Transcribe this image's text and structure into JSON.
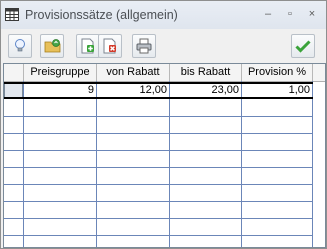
{
  "window": {
    "title": "Provisionssätze (allgemein)"
  },
  "window_controls": {
    "minimize": "–",
    "maximize": "▫",
    "close": "×"
  },
  "toolbar": {
    "buttons": [
      "lightbulb-icon",
      "folder-refresh-icon",
      "add-record-icon",
      "delete-record-icon",
      "print-icon",
      "confirm-check-icon"
    ]
  },
  "table": {
    "columns": [
      "Preisgruppe",
      "von Rabatt",
      "bis Rabatt",
      "Provision %"
    ],
    "rows": [
      {
        "preisgruppe": "9",
        "von_rabatt": "12,00",
        "bis_rabatt": "23,00",
        "provision": "1,00"
      }
    ]
  },
  "colors": {
    "grid_line": "#6b86b8",
    "confirm_green": "#3aa33a",
    "delete_red": "#d23a2a"
  }
}
